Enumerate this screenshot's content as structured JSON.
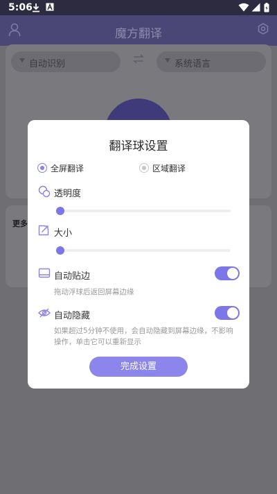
{
  "status_bar": {
    "time": "5:06"
  },
  "app": {
    "title": "魔方翻译"
  },
  "lang_bar": {
    "source": "自动识别",
    "target": "系统语言"
  },
  "more_section": {
    "label": "更多"
  },
  "modal": {
    "title": "翻译球设置",
    "radios": [
      {
        "label": "全屏翻译",
        "selected": true
      },
      {
        "label": "区域翻译",
        "selected": false
      }
    ],
    "opacity": {
      "label": "透明度",
      "value": 0
    },
    "size": {
      "label": "大小",
      "value": 0
    },
    "auto_snap": {
      "label": "自动贴边",
      "enabled": true,
      "description": "拖动浮球后返回屏幕边缘"
    },
    "auto_hide": {
      "label": "自动隐藏",
      "enabled": true,
      "description_line1": "如果超过5分钟不使用，会自动隐藏到屏幕边缘，不影响",
      "description_line2": "操作，单击它可以重新显示"
    },
    "done_button": "完成设置"
  },
  "colors": {
    "accent": "#7d76e6",
    "scrim": "#6e6e73",
    "header": "#4a4777"
  }
}
